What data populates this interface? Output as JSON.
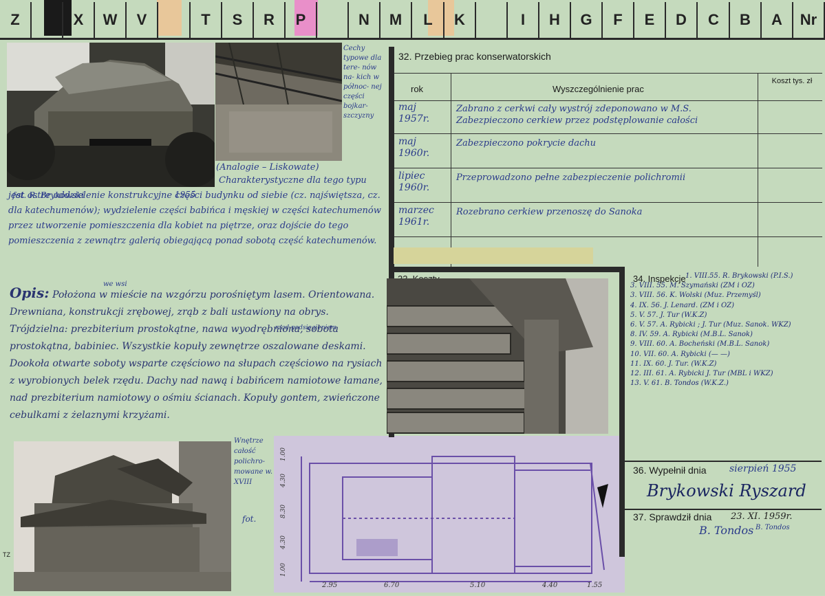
{
  "header": {
    "letters": [
      "Z",
      "",
      "X",
      "W",
      "V",
      "",
      "T",
      "S",
      "R",
      "P",
      "",
      "N",
      "M",
      "L",
      "K",
      "",
      "I",
      "H",
      "G",
      "F",
      "E",
      "D",
      "C",
      "B",
      "A",
      "Nr"
    ]
  },
  "photo_captions": {
    "top_left": "fot. R. Brykowski",
    "top_left_year": "1955",
    "top_right_note": "Cechy typowe dla tere- nów na- kich w północ- nej części bojkar- szczyzny",
    "bottom_note": "Wnętrze całość polichro- mowane w. XVIII",
    "bottom_fot": "fot."
  },
  "analogy": "(Analogie – Liskowate)",
  "characteristic_text": "Charakterystyczne dla tego typu jest ostre oddzielenie konstrukcyjne części budynku od siebie (cz. najświętsza, cz. dla katechumenów); wydzielenie części babińca i męskiej w części katechumenów przez utworzenie pomieszczenia dla kobiet na piętrze, oraz dojście do tego pomieszczenia z zewnątrz galerią obiegającą ponad sobotą część katechumenów.",
  "opis": {
    "label": "Opis:",
    "insert": "we wsi",
    "insert2": "rząd podsięgieniem",
    "text": "Położona w mieście na wzgórzu porośniętym lasem. Orientowana. Drewniana, konstrukcji zrębowej, zrąb z bali ustawiony na obrys. Trójdzielna: prezbiterium prostokątne, nawa wyodrębniona, sobota prostokątna, babiniec. Wszystkie kopuły zewnętrze oszalowane deskami. Dookoła otwarte soboty wsparte częściowo na słupach częściowo na rysiach z wyrobionych belek rzędu. Dachy nad nawą i babińcem namiotowe łamane, nad prezbiterium namiotowy o ośmiu ścianach. Kopuły gontem, zwieńczone cebulkami z żelaznymi krzyżami."
  },
  "section32": {
    "title": "32. Przebieg prac konserwatorskich",
    "col_rok": "rok",
    "col_desc": "Wyszczególnienie prac",
    "col_koszt": "Koszt tys. zł",
    "rows": [
      {
        "rok": "maj 1957r.",
        "desc": "Zabrano z cerkwi cały wystrój zdeponowano w M.S. Zabezpieczono cerkiew przez podstęplowanie całości"
      },
      {
        "rok": "maj 1960r.",
        "desc": "Zabezpieczono pokrycie dachu"
      },
      {
        "rok": "lipiec 1960r.",
        "desc": "Przeprowadzono pełne zabezpieczenie polichromii"
      },
      {
        "rok": "marzec 1961r.",
        "desc": "Rozebrano cerkiew przenoszę do Sanoka"
      }
    ]
  },
  "section33": {
    "title": "33. Koszty"
  },
  "section34": {
    "title": "34. Inspekcje",
    "entries": [
      "1. VIII.55. R. Brykowski (P.I.S.)",
      "3. VIII. 55. M. Szymański (ZM i OZ)",
      "3. VIII. 56. K. Wolski (Muz. Przemyśl)",
      "4. IX. 56. J. Lenard. (ZM i OZ)",
      "5. V. 57. J. Tur (W.K.Z)",
      "6. V. 57. A. Rybicki ; J. Tur (Muz. Sanok. WKZ)",
      "8. IV. 59. A. Rybicki (M.B.L. Sanok)",
      "9. VIII. 60. A. Bocheński (M.B.L. Sanok)",
      "10. VII. 60. A. Rybicki (— —)",
      "11. IX. 60. J. Tur. (W.K.Z)",
      "12. III. 61. A. Rybicki J. Tur (MBL i WKZ)",
      "13. V. 61. B. Tondos (W.K.Z.)"
    ]
  },
  "section36": {
    "label": "36. Wypełnił dnia",
    "date": "sierpień 1955",
    "signature": "Brykowski Ryszard"
  },
  "section37": {
    "label": "37. Sprawdził dnia",
    "date": "23. XI. 1959r.",
    "signature": "B. Tondos",
    "signature_print": "B. Tondos"
  },
  "plan": {
    "dims_bottom": [
      "2.95",
      "6.70",
      "5.10",
      "4.40",
      "1.55"
    ],
    "dims_left": [
      "1.00",
      "4.30",
      "8.30",
      "4.30",
      "1.00"
    ]
  },
  "side_mark": "TZ"
}
